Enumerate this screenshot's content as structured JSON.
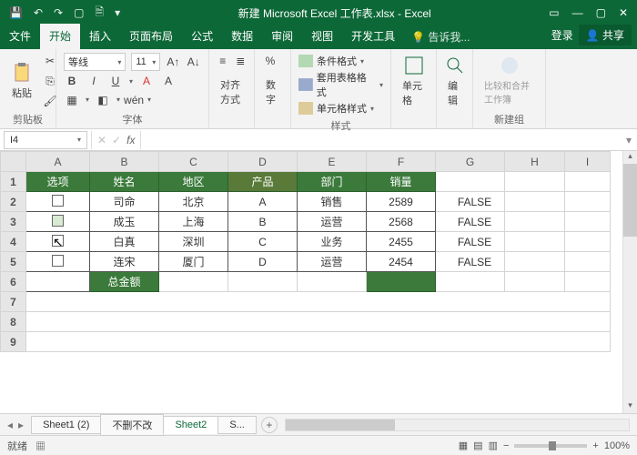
{
  "titlebar": {
    "title": "新建 Microsoft Excel 工作表.xlsx - Excel"
  },
  "tabs": {
    "file": "文件",
    "home": "开始",
    "insert": "插入",
    "layout": "页面布局",
    "formulas": "公式",
    "data": "数据",
    "review": "审阅",
    "view": "视图",
    "dev": "开发工具",
    "tellme": "告诉我...",
    "login": "登录",
    "share": "共享"
  },
  "ribbon": {
    "clipboard": {
      "paste": "粘贴",
      "label": "剪贴板"
    },
    "font": {
      "name": "等线",
      "size": "11",
      "label": "字体"
    },
    "align": {
      "label": "对齐方式"
    },
    "number": {
      "label": "数字"
    },
    "styles": {
      "cond": "条件格式",
      "table": "套用表格格式",
      "cell": "单元格样式",
      "label": "样式"
    },
    "cells": {
      "label": "单元格"
    },
    "editing": {
      "label": "编辑"
    },
    "workbook": {
      "btn": "比较和合并工作簿",
      "label": "新建组"
    }
  },
  "fbar": {
    "ref": "I4",
    "fx": "fx"
  },
  "grid": {
    "cols": [
      "A",
      "B",
      "C",
      "D",
      "E",
      "F",
      "G",
      "H",
      "I"
    ],
    "headers": [
      "选项",
      "姓名",
      "地区",
      "产品",
      "部门",
      "销量"
    ],
    "rows": [
      {
        "name": "司命",
        "region": "北京",
        "product": "A",
        "dept": "销售",
        "sales": "2589",
        "g": "FALSE"
      },
      {
        "name": "成玉",
        "region": "上海",
        "product": "B",
        "dept": "运营",
        "sales": "2568",
        "g": "FALSE"
      },
      {
        "name": "白真",
        "region": "深圳",
        "product": "C",
        "dept": "业务",
        "sales": "2455",
        "g": "FALSE"
      },
      {
        "name": "连宋",
        "region": "厦门",
        "product": "D",
        "dept": "运营",
        "sales": "2454",
        "g": "FALSE"
      }
    ],
    "total_label": "总金额"
  },
  "sheets": {
    "s1": "Sheet1 (2)",
    "s2": "不删不改",
    "s3": "Sheet2",
    "s4": "S..."
  },
  "status": {
    "ready": "就绪",
    "zoom": "100%"
  }
}
